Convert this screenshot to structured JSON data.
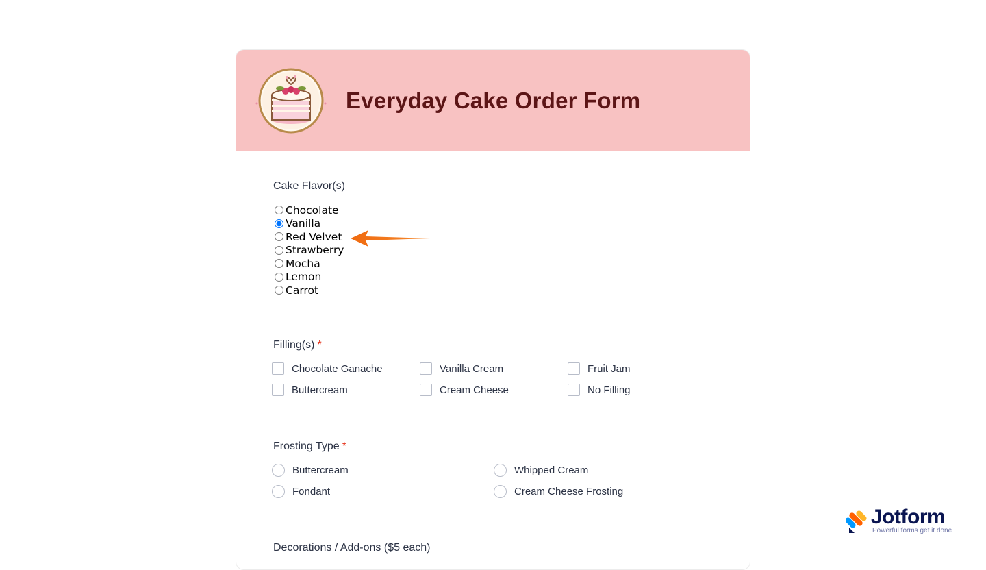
{
  "form": {
    "title": "Everyday Cake Order Form",
    "header_color": "#f8c2c2",
    "title_color": "#5c1516"
  },
  "flavor": {
    "label": "Cake Flavor(s)",
    "selected": "Vanilla",
    "options": [
      "Chocolate",
      "Vanilla",
      "Red Velvet",
      "Strawberry",
      "Mocha",
      "Lemon",
      "Carrot"
    ]
  },
  "filling": {
    "label": "Filling(s)",
    "required_mark": "*",
    "options": [
      "Chocolate Ganache",
      "Vanilla Cream",
      "Fruit Jam",
      "Buttercream",
      "Cream Cheese",
      "No Filling"
    ]
  },
  "frosting": {
    "label": "Frosting Type",
    "required_mark": "*",
    "options": [
      "Buttercream",
      "Whipped Cream",
      "Fondant",
      "Cream Cheese Frosting"
    ]
  },
  "decorations": {
    "label": "Decorations / Add-ons ($5 each)"
  },
  "annotation": {
    "arrow_color": "#f06a0f",
    "icon": "arrow-left-icon"
  },
  "branding": {
    "name": "Jotform",
    "tagline": "Powerful forms get it done",
    "icon": "jotform-logo-icon"
  }
}
